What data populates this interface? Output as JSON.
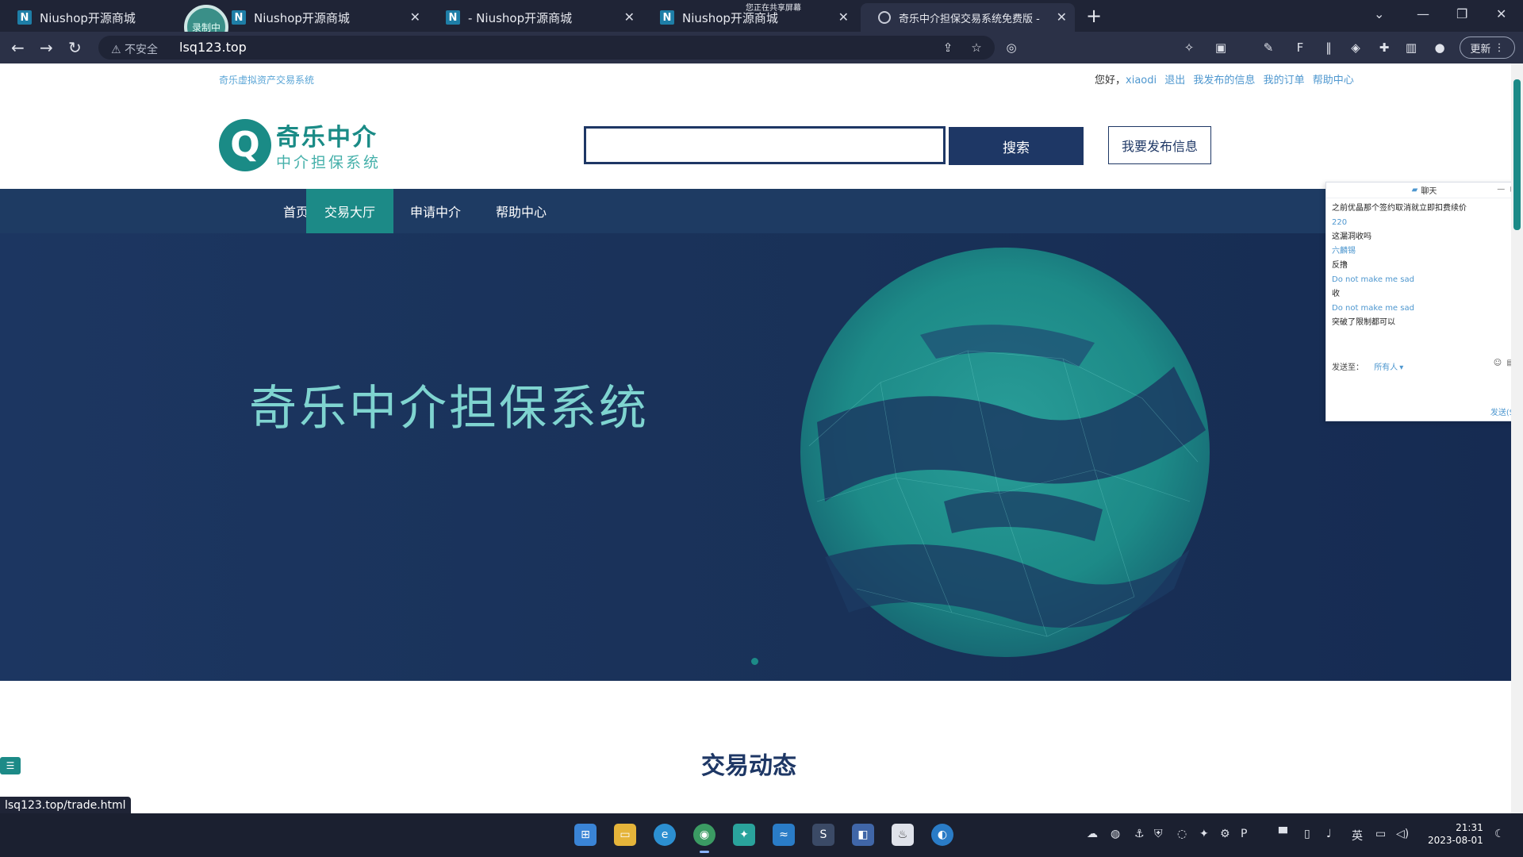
{
  "browser": {
    "tabs": [
      {
        "label": "Niushop开源商城",
        "icon": "n-favicon"
      },
      {
        "label": "Niushop开源商城",
        "icon": "n-favicon"
      },
      {
        "label": "- Niushop开源商城",
        "icon": "n-favicon"
      },
      {
        "label": "Niushop开源商城",
        "icon": "n-favicon"
      },
      {
        "label": "奇乐中介担保交易系统免费版 -",
        "icon": "globe-favicon"
      }
    ],
    "recording_badge": "录制中",
    "share_notice": "您正在共享屏幕",
    "address": {
      "security": "不安全",
      "url": "lsq123.top"
    },
    "update_label": "更新"
  },
  "page": {
    "top_left_text": "奇乐虚拟资产交易系统",
    "user_bar": {
      "greeting": "您好，",
      "username": "xiaodi",
      "logout": "退出",
      "my_posts": "我发布的信息",
      "my_orders": "我的订单",
      "help": "帮助中心"
    },
    "logo": {
      "mark": "Q",
      "title": "奇乐中介",
      "subtitle": "中介担保系统"
    },
    "search": {
      "placeholder": "",
      "button": "搜索"
    },
    "post_button": "我要发布信息",
    "nav": [
      {
        "label": "首页",
        "active": false
      },
      {
        "label": "交易大厅",
        "active": true
      },
      {
        "label": "申请中介",
        "active": false
      },
      {
        "label": "帮助中心",
        "active": false
      }
    ],
    "banner_title": "奇乐中介担保系统",
    "section_title": "交易动态",
    "status_url": "lsq123.top/trade.html"
  },
  "chat": {
    "title": "聊天",
    "messages": [
      {
        "text": "之前优晶那个签约取消就立即扣费续价",
        "color": "black"
      },
      {
        "text": "220",
        "color": "blue"
      },
      {
        "text": "这漏洞收吗",
        "color": "black"
      },
      {
        "text": "六麟锡",
        "color": "blue"
      },
      {
        "text": "反撸",
        "color": "black"
      },
      {
        "text": "Do not make me sad",
        "color": "blue"
      },
      {
        "text": "收",
        "color": "black"
      },
      {
        "text": "Do not make me sad",
        "color": "blue"
      },
      {
        "text": "突破了限制都可以",
        "color": "black"
      }
    ],
    "send_to_label": "发送至：",
    "send_to_value": "所有人",
    "send_button": "发送(S)"
  },
  "taskbar": {
    "clock_time": "21:31",
    "clock_date": "2023-08-01",
    "ime": "英"
  },
  "colors": {
    "brand_teal": "#1c8a87",
    "brand_navy": "#1e3765",
    "banner_bg": "#1c3661",
    "chrome_bg": "#1f2436"
  }
}
